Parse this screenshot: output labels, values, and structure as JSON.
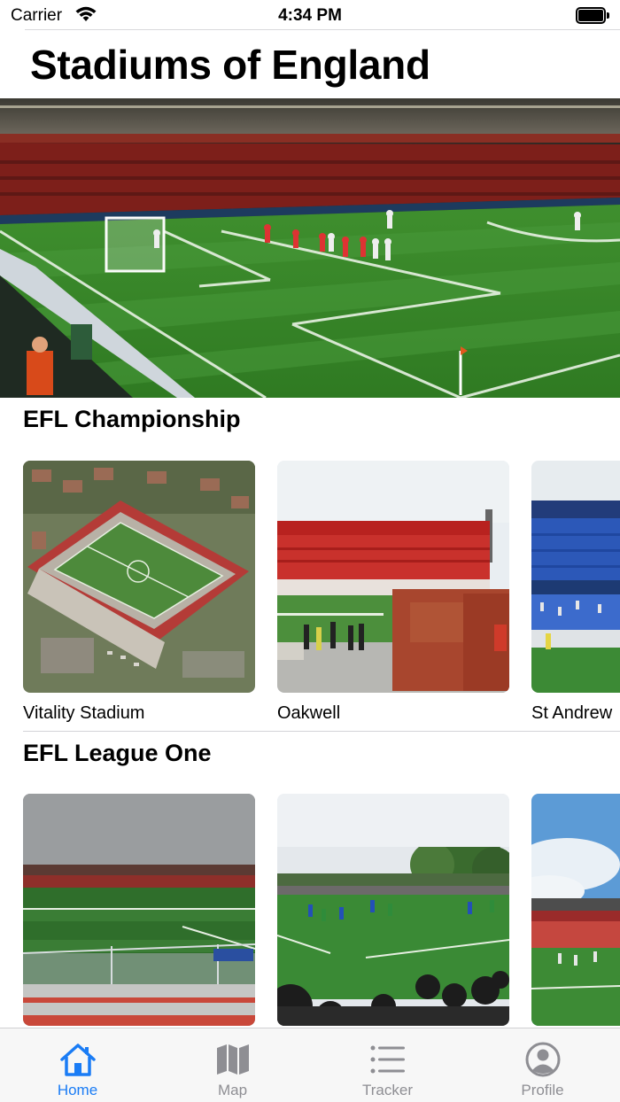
{
  "status_bar": {
    "carrier": "Carrier",
    "time": "4:34 PM"
  },
  "page": {
    "title": "Stadiums of England"
  },
  "sections": [
    {
      "title": "EFL Championship",
      "stadiums": [
        {
          "name": "Vitality Stadium"
        },
        {
          "name": "Oakwell"
        },
        {
          "name": "St Andrew"
        }
      ]
    },
    {
      "title": "EFL League One",
      "stadiums": [
        {
          "name": ""
        },
        {
          "name": ""
        },
        {
          "name": ""
        }
      ]
    }
  ],
  "tab_bar": {
    "items": [
      {
        "label": "Home",
        "icon": "house-icon",
        "active": true
      },
      {
        "label": "Map",
        "icon": "map-icon",
        "active": false
      },
      {
        "label": "Tracker",
        "icon": "list-icon",
        "active": false
      },
      {
        "label": "Profile",
        "icon": "person-circle-icon",
        "active": false
      }
    ],
    "active_color": "#1a7cf5",
    "inactive_color": "#8e8e93"
  }
}
